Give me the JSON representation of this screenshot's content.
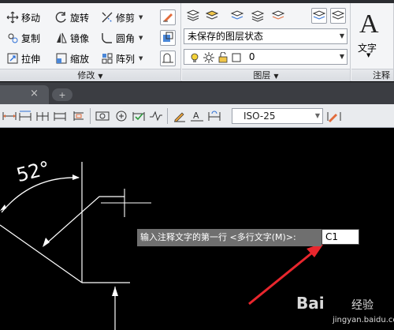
{
  "ribbon": {
    "modify_panel": {
      "title": "修改",
      "tools": {
        "move": "移动",
        "rotate": "旋转",
        "trim": "修剪",
        "copy": "复制",
        "mirror": "镜像",
        "fillet": "圆角",
        "stretch": "拉伸",
        "scale": "缩放",
        "array": "阵列"
      }
    },
    "layers_panel": {
      "title": "图层",
      "layer_state": "未保存的图层状态",
      "current_layer": "0"
    },
    "annotation_panel": {
      "title": "注释",
      "text_label": "文字",
      "text_icon": "A"
    }
  },
  "tabs": {
    "close_symbol": "×",
    "new_tab_symbol": "+"
  },
  "dim_toolbar": {
    "dimstyle": "ISO-25"
  },
  "drawing": {
    "angle_label": "52°"
  },
  "command": {
    "prompt": "输入注释文字的第一行 <多行文字(M)>:",
    "input_value": "C1"
  },
  "watermark": {
    "brand": "Bai",
    "label": "经验",
    "domain": "jingyan.baidu.com"
  },
  "colors": {
    "canvas": "#000000",
    "ribbon": "#f4f5f7",
    "annotation_arrow": "#e8262d",
    "prompt_bg": "#6f6f6f"
  }
}
